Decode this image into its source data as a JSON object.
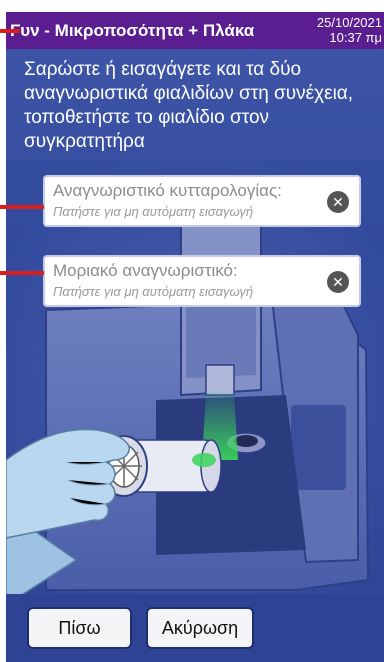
{
  "header": {
    "title": "Γυν - Μικροποσότητα + Πλάκα",
    "date": "25/10/2021",
    "time": "10:37 πμ"
  },
  "instruction": "Σαρώστε ή εισαγάγετε και τα δύο αναγνωριστικά φιαλιδίων στη συνέχεια, τοποθετήστε το φιαλίδιο στον συγκρατητήρα",
  "fields": [
    {
      "label": "Αναγνωριστικό κυτταρολογίας:",
      "hint": "Πατήστε για μη αυτόματη εισαγωγή",
      "clear_icon": "clear-icon"
    },
    {
      "label": "Μοριακό αναγνωριστικό:",
      "hint": "Πατήστε για μη αυτόματη εισαγωγή",
      "clear_icon": "clear-icon"
    }
  ],
  "buttons": {
    "back": "Πίσω",
    "cancel": "Ακύρωση"
  },
  "colors": {
    "header_bg": "#5a1e91",
    "screen_bg": "#324a9c",
    "callout": "#d81e1e",
    "scan_light": "#3bd35a"
  }
}
